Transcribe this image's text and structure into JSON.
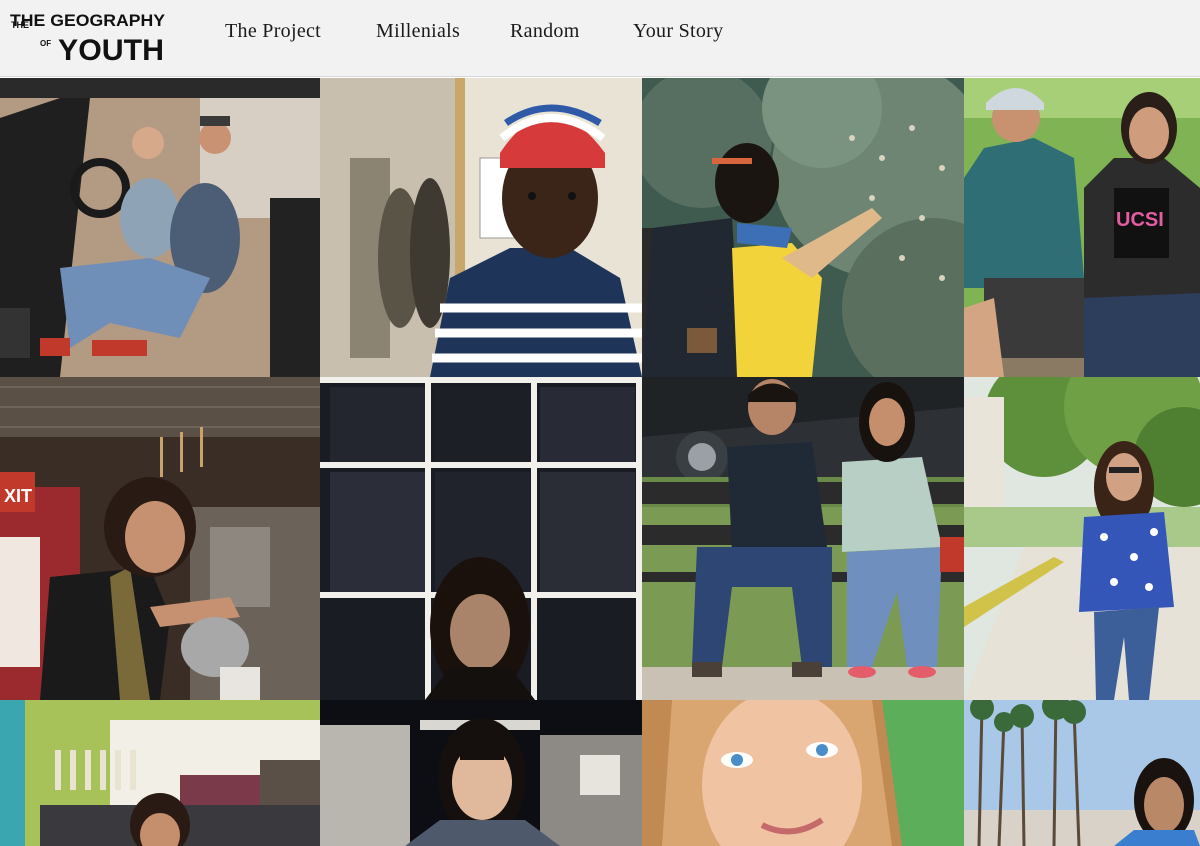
{
  "header": {
    "logo": {
      "line1": "THE GEOGRAPHY",
      "line2": "OF",
      "line3": "YOUTH",
      "alt": "The Geography of Youth"
    },
    "nav": [
      {
        "label": "The Project"
      },
      {
        "label": "Millenials"
      },
      {
        "label": "Random"
      },
      {
        "label": "Your Story"
      }
    ]
  },
  "gallery": {
    "columns": 4,
    "photos": [
      {
        "subject": "two young men sitting in an open black jeep"
      },
      {
        "subject": "young man in red white and blue striped beanie and striped polo at a laundromat"
      },
      {
        "subject": "young woman with backpack and yellow shirt touching a flowering bush"
      },
      {
        "subject": "young man in cap and young woman in UCSD shirt sitting on grass"
      },
      {
        "subject": "barista pouring from a milk pitcher in a cafe"
      },
      {
        "subject": "young woman seen through a dark window with white frames"
      },
      {
        "subject": "young man and young woman sitting on a park bench"
      },
      {
        "subject": "young woman in blue floral top standing on a sunny path"
      },
      {
        "subject": "young woman behind a cafe counter"
      },
      {
        "subject": "young woman with glasses standing at a night market"
      },
      {
        "subject": "close-up of young woman with blue eyes and light brown hair"
      },
      {
        "subject": "young woman on a palm tree lined street"
      }
    ]
  }
}
